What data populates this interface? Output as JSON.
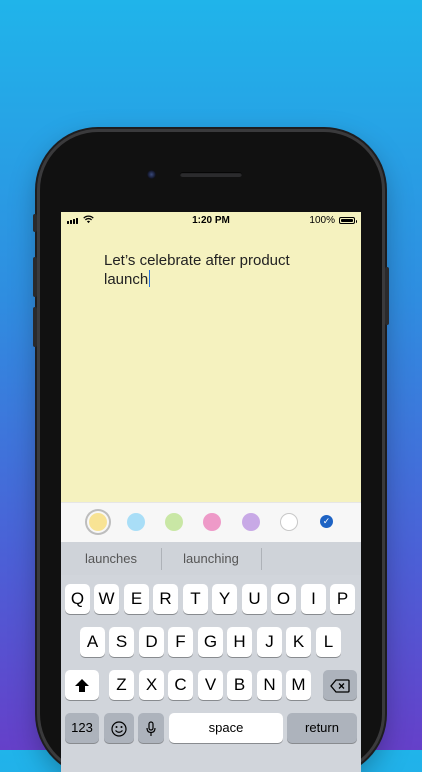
{
  "status": {
    "time": "1:20 PM",
    "battery": "100%"
  },
  "note": {
    "text": "Let’s celebrate after product launch"
  },
  "colors": [
    {
      "name": "yellow",
      "hex": "#f8e394",
      "selected": true
    },
    {
      "name": "blue",
      "hex": "#a9def7"
    },
    {
      "name": "green",
      "hex": "#c9e7a5"
    },
    {
      "name": "pink",
      "hex": "#ee9ac8"
    },
    {
      "name": "purple",
      "hex": "#c8a9e6"
    },
    {
      "name": "white",
      "hex": "#ffffff"
    }
  ],
  "suggestions": [
    "launches",
    "launching",
    ""
  ],
  "keyboard": {
    "row1": [
      "Q",
      "W",
      "E",
      "R",
      "T",
      "Y",
      "U",
      "O",
      "I",
      "P"
    ],
    "row2": [
      "A",
      "S",
      "D",
      "F",
      "G",
      "H",
      "J",
      "K",
      "L"
    ],
    "row3": [
      "Z",
      "X",
      "C",
      "V",
      "B",
      "N",
      "M"
    ],
    "numbers_key": "123",
    "space_key": "space",
    "return_key": "return"
  }
}
